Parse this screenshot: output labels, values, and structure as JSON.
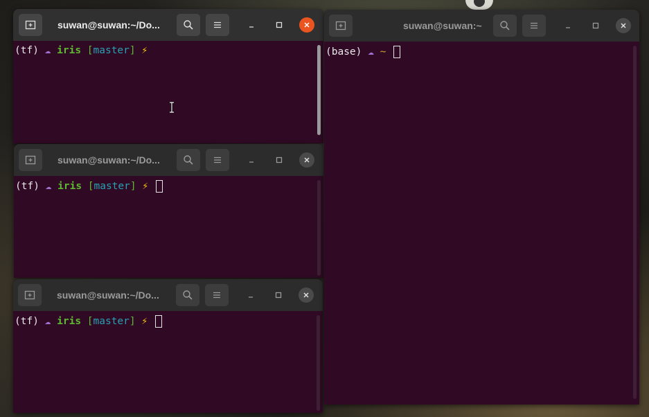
{
  "windows": [
    {
      "id": "top-left",
      "title": "suwan@suwan:~/Do...",
      "active": true,
      "prompt": {
        "env": "(tf)",
        "cloud": "☁",
        "dir": "iris",
        "branch_open": "[",
        "branch": "master",
        "branch_close": "]",
        "bolt": "⚡"
      },
      "has_cursor": false
    },
    {
      "id": "middle-left",
      "title": "suwan@suwan:~/Do...",
      "active": false,
      "prompt": {
        "env": "(tf)",
        "cloud": "☁",
        "dir": "iris",
        "branch_open": "[",
        "branch": "master",
        "branch_close": "]",
        "bolt": "⚡"
      },
      "has_cursor": true
    },
    {
      "id": "bottom-left",
      "title": "suwan@suwan:~/Do...",
      "active": false,
      "prompt": {
        "env": "(tf)",
        "cloud": "☁",
        "dir": "iris",
        "branch_open": "[",
        "branch": "master",
        "branch_close": "]",
        "bolt": "⚡"
      },
      "has_cursor": true
    },
    {
      "id": "right",
      "title": "suwan@suwan:~",
      "active": false,
      "prompt": {
        "env": "(base)",
        "cloud": "☁",
        "dir": "~"
      },
      "has_cursor": true
    }
  ],
  "icons": {
    "new_tab": "new-tab-icon",
    "search": "search-icon",
    "menu": "hamburger-menu-icon",
    "minimize": "minimize-icon",
    "maximize": "maximize-icon",
    "close": "close-icon"
  },
  "colors": {
    "terminal_bg": "#300a24",
    "titlebar_bg": "#2c2c2c",
    "close_active": "#e95420",
    "prompt_dir": "#5fb832",
    "prompt_branch": "#2aa1b3",
    "prompt_bolt": "#f1c40f",
    "prompt_cloud": "#9f6fd0"
  }
}
